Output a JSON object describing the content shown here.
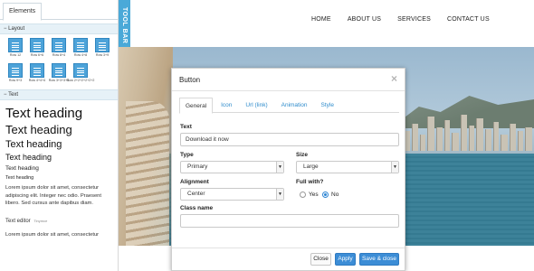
{
  "panel": {
    "tab_label": "Elements",
    "layout_section": "− Layout",
    "text_section": "− Text",
    "rows": [
      {
        "label": "Row 12",
        "lines": 4
      },
      {
        "label": "Row 6+6",
        "lines": 4
      },
      {
        "label": "Row 8+4",
        "lines": 4
      },
      {
        "label": "Row 4+8",
        "lines": 4
      },
      {
        "label": "Row 3+9",
        "lines": 4
      },
      {
        "label": "Row 9+3",
        "lines": 4
      },
      {
        "label": "Row 4+4+4",
        "lines": 4
      },
      {
        "label": "Row 3+3+3+3",
        "lines": 4
      },
      {
        "label": "Row 2+2+2+2+2+2",
        "lines": 4
      }
    ],
    "text": {
      "h1": "Text heading",
      "h2": "Text heading",
      "h3": "Text heading",
      "h4": "Text heading",
      "h5": "Text heading",
      "h6": "Text heading",
      "paragraph": "Lorem ipsum dolor sit amet, consectetur adipiscing elit. Integer nec odio. Praesent libero. Sed cursus ante dapibus diam.",
      "editor_label": "Text editor",
      "editor_note": "Tinymce",
      "paragraph2": "Lorem ipsum dolor sit amet, consectetur"
    }
  },
  "toolbar_tab": "TOOL BAR",
  "site_nav": [
    "HOME",
    "ABOUT US",
    "SERVICES",
    "CONTACT US"
  ],
  "modal": {
    "title": "Button",
    "close_glyph": "×",
    "tabs": [
      "General",
      "Icon",
      "Url (link)",
      "Animation",
      "Style"
    ],
    "active_tab": "General",
    "fields": {
      "text_label": "Text",
      "text_value": "Download it now",
      "type_label": "Type",
      "type_value": "Primary",
      "size_label": "Size",
      "size_value": "Large",
      "alignment_label": "Alignment",
      "alignment_value": "Center",
      "fullwidth_label": "Full with?",
      "radio_yes": "Yes",
      "radio_no": "No",
      "fullwidth_selected": "No",
      "classname_label": "Class name",
      "classname_value": ""
    },
    "buttons": {
      "close": "Close",
      "apply": "Apply",
      "save_close": "Save & close"
    }
  },
  "colors": {
    "accent": "#4aa9d8",
    "primary_button": "#3c8dd6",
    "row_thumb": "#4da3d9",
    "section_bg": "#e6f1f7"
  }
}
